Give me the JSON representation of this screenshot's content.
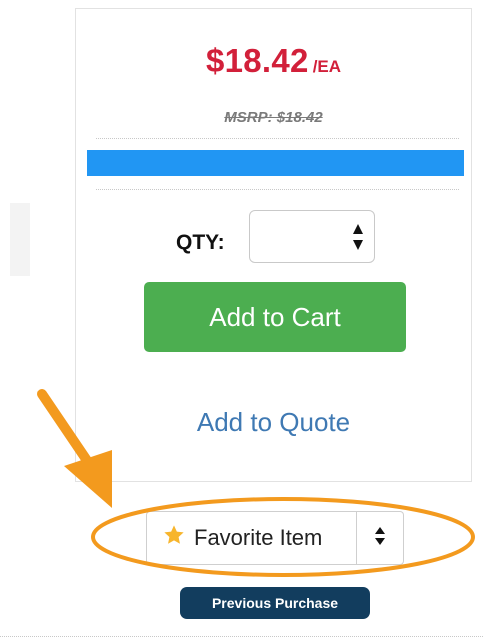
{
  "product": {
    "price": "$18.42",
    "unit": "/EA",
    "msrp": "MSRP: $18.42"
  },
  "quantity": {
    "label": "QTY:",
    "value": ""
  },
  "actions": {
    "add_to_cart": "Add to Cart",
    "add_to_quote": "Add to Quote",
    "favorite": "Favorite Item"
  },
  "badges": {
    "previous_purchase": "Previous Purchase"
  },
  "colors": {
    "price": "#d2203a",
    "bar": "#2196f3",
    "cart_button": "#4cae50",
    "quote_link": "#3f79b3",
    "badge": "#123d5e",
    "annotation": "#f39a1e",
    "star": "#f7b52c"
  },
  "icons": {
    "favorite": "star-icon",
    "stepper": "up-down-arrows-icon",
    "toggle": "up-down-caret-icon"
  }
}
